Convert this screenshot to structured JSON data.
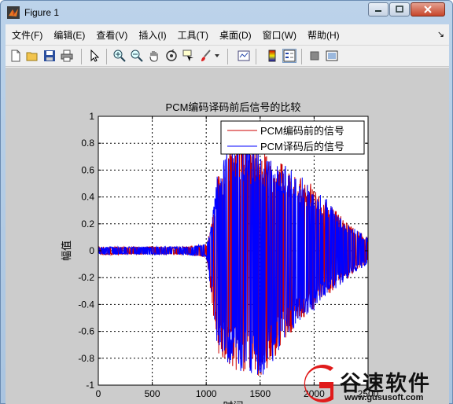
{
  "window": {
    "title": "Figure 1"
  },
  "menubar": {
    "items": [
      "文件(F)",
      "编辑(E)",
      "查看(V)",
      "插入(I)",
      "工具(T)",
      "桌面(D)",
      "窗口(W)",
      "帮助(H)"
    ],
    "dock_glyph": "↘"
  },
  "toolbar": {
    "buttons": [
      "new-figure",
      "open-file",
      "save",
      "print",
      "edit-plot",
      "zoom-in",
      "zoom-out",
      "pan",
      "rotate-3d",
      "data-cursor",
      "brush",
      "link-plot",
      "colorbar",
      "legend",
      "hide-plot-tools",
      "show-plot-tools"
    ]
  },
  "colors": {
    "series_encoded_before": "#cc0000",
    "series_encoded_after": "#0000ff",
    "figure_bg": "#cccccc"
  },
  "chart_data": {
    "type": "line",
    "title": "PCM编码译码前后信号的比较",
    "xlabel": "时间",
    "ylabel": "幅值",
    "xlim": [
      0,
      2500
    ],
    "ylim": [
      -1,
      1
    ],
    "xticks": [
      0,
      500,
      1000,
      1500,
      2000,
      2500
    ],
    "xtick_labels": [
      "0",
      "500",
      "1000",
      "1500",
      "2000",
      "2500"
    ],
    "yticks": [
      -1,
      -0.8,
      -0.6,
      -0.4,
      -0.2,
      0,
      0.2,
      0.4,
      0.6,
      0.8,
      1
    ],
    "ytick_labels": [
      "-1",
      "-0.8",
      "-0.6",
      "-0.4",
      "-0.2",
      "0",
      "0.2",
      "0.4",
      "0.6",
      "0.8",
      "1"
    ],
    "grid": true,
    "legend_position": "top-right",
    "series": [
      {
        "name": "PCM编码前的信号",
        "color": "#cc0000",
        "x": [
          0,
          200,
          400,
          600,
          800,
          1000,
          1050,
          1100,
          1200,
          1300,
          1400,
          1500,
          1600,
          1700,
          1800,
          1900,
          2000,
          2100,
          2200,
          2300,
          2400,
          2500
        ],
        "upper": [
          0.03,
          0.03,
          0.03,
          0.03,
          0.03,
          0.05,
          0.2,
          0.55,
          0.75,
          0.85,
          0.8,
          0.75,
          0.7,
          0.65,
          0.6,
          0.55,
          0.48,
          0.4,
          0.3,
          0.22,
          0.15,
          0.1
        ],
        "lower": [
          -0.03,
          -0.03,
          -0.03,
          -0.03,
          -0.03,
          -0.05,
          -0.35,
          -0.75,
          -0.85,
          -0.9,
          -0.92,
          -0.95,
          -0.85,
          -0.7,
          -0.6,
          -0.5,
          -0.45,
          -0.35,
          -0.28,
          -0.22,
          -0.15,
          -0.1
        ]
      },
      {
        "name": "PCM译码后的信号",
        "color": "#0000ff",
        "x": [
          0,
          200,
          400,
          600,
          800,
          1000,
          1050,
          1100,
          1200,
          1300,
          1400,
          1500,
          1600,
          1700,
          1800,
          1900,
          2000,
          2100,
          2200,
          2300,
          2400,
          2500
        ],
        "upper": [
          0.03,
          0.03,
          0.03,
          0.03,
          0.03,
          0.05,
          0.2,
          0.55,
          0.75,
          0.85,
          0.8,
          0.75,
          0.7,
          0.65,
          0.6,
          0.55,
          0.48,
          0.4,
          0.3,
          0.22,
          0.15,
          0.1
        ],
        "lower": [
          -0.03,
          -0.03,
          -0.03,
          -0.03,
          -0.03,
          -0.05,
          -0.35,
          -0.75,
          -0.85,
          -0.9,
          -0.92,
          -0.95,
          -0.85,
          -0.7,
          -0.6,
          -0.5,
          -0.45,
          -0.35,
          -0.28,
          -0.22,
          -0.15,
          -0.1
        ]
      }
    ]
  },
  "watermark": {
    "name": "谷速软件",
    "url": "www.gususoft.com"
  }
}
